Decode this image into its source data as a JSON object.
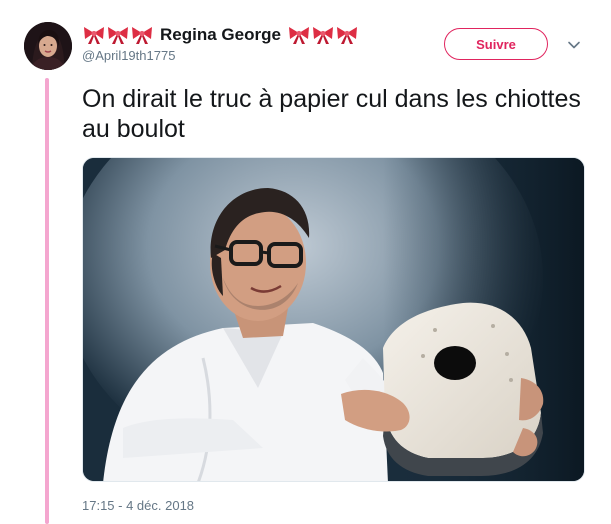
{
  "tweet": {
    "author": {
      "display_name": "Regina George",
      "handle": "@April19th1775",
      "avatar_icon": "profile-photo",
      "name_emoji": "bow-ribbon-emoji"
    },
    "follow_label": "Suivre",
    "text": "On dirait le truc à papier cul dans les chiottes au boulot",
    "timestamp": "17:15 - 4 déc. 2018"
  },
  "colors": {
    "accent": "#e0245e",
    "thread_line": "#f4a6cf",
    "secondary_text": "#657786",
    "primary_text": "#14171a"
  }
}
